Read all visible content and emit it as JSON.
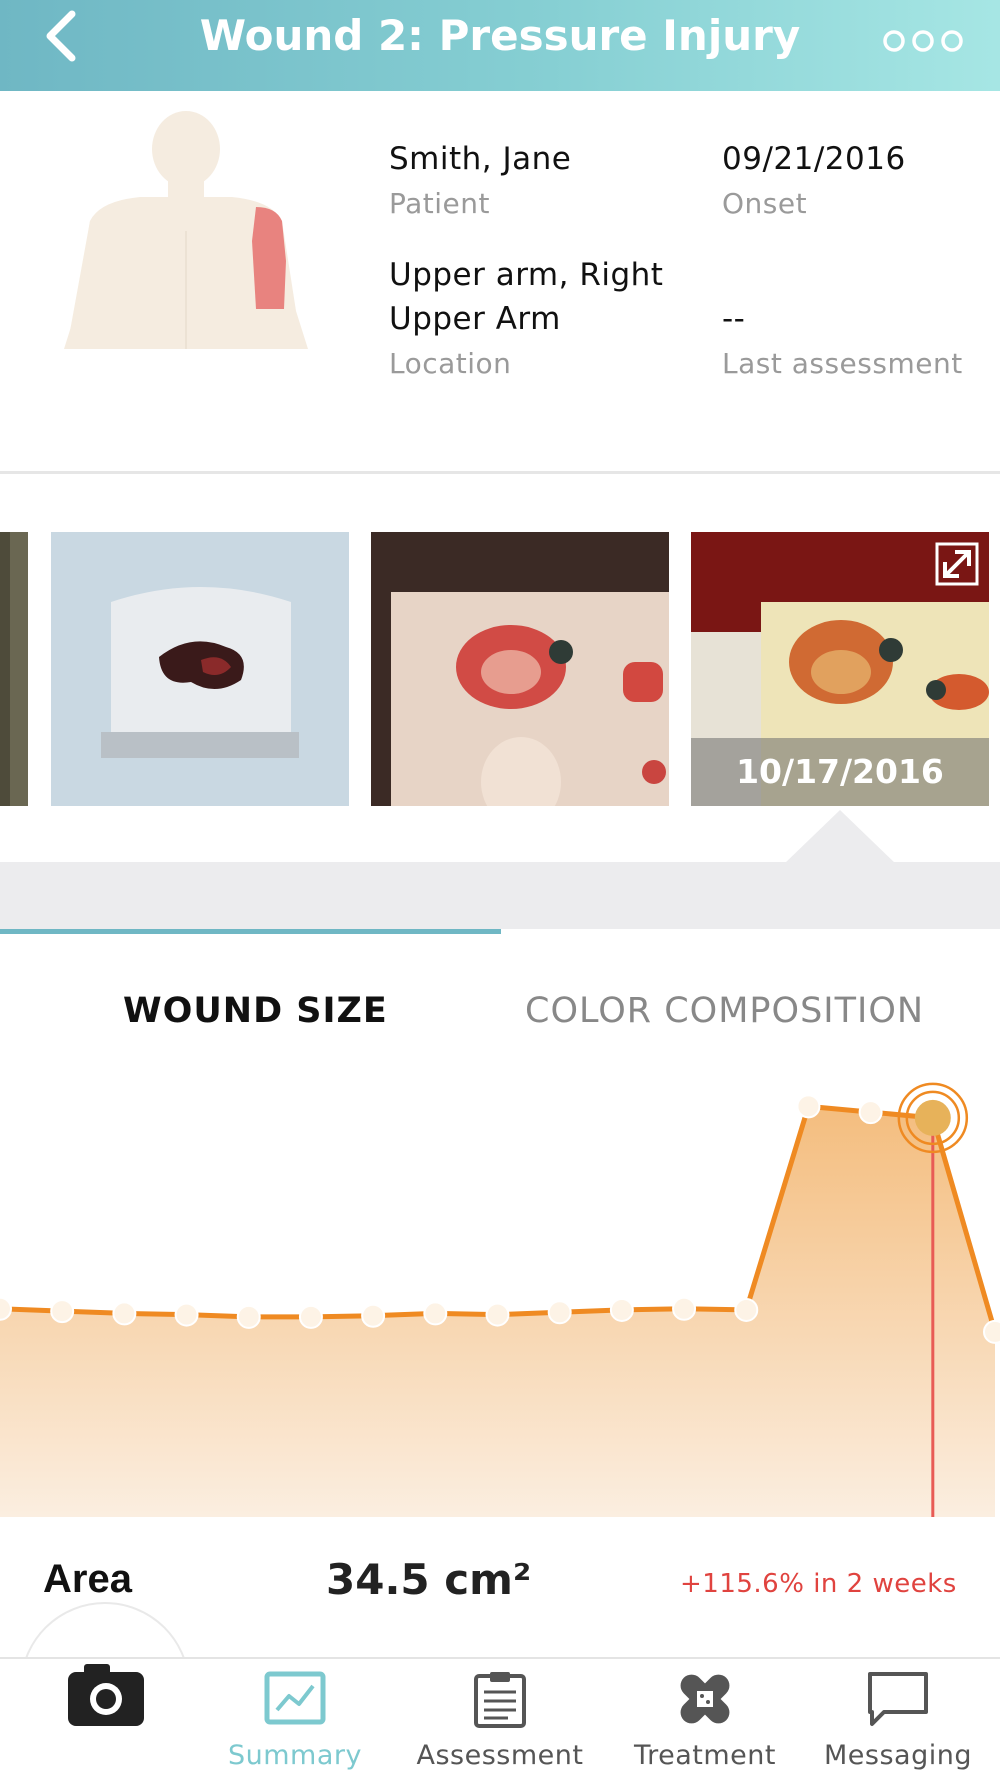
{
  "header": {
    "title": "Wound 2: Pressure Injury",
    "back_icon": "chevron-left-icon",
    "more_icon": "more-dots-icon",
    "colors": {
      "gradient_start": "#6fb7c4",
      "gradient_end": "#a6e6e4"
    }
  },
  "patient": {
    "name": "Smith, Jane",
    "name_label": "Patient",
    "onset": "09/21/2016",
    "onset_label": "Onset",
    "location_line1": "Upper arm, Right",
    "location_line2": "Upper Arm",
    "location_label": "Location",
    "last_assessment": "--",
    "last_assessment_label": "Last assessment",
    "body_map": {
      "highlighted_region": "right upper arm",
      "highlight_color": "#e8837f",
      "skin_color": "#f5ece0"
    }
  },
  "gallery": {
    "selected_date": "10/17/2016",
    "expand_icon": "expand-icon"
  },
  "tabs": {
    "items": [
      {
        "label": "WOUND SIZE",
        "active": true
      },
      {
        "label": "COLOR COMPOSITION",
        "active": false
      }
    ],
    "indicator_color": "#6fb7c4"
  },
  "chart_data": {
    "type": "area",
    "series": [
      {
        "values": [
          18.0,
          17.8,
          17.6,
          17.5,
          17.3,
          17.3,
          17.4,
          17.6,
          17.5,
          17.7,
          17.9,
          18.0,
          17.9,
          35.5,
          35.0,
          34.5,
          16.0
        ]
      }
    ],
    "selected_index": 15,
    "colors": {
      "line": "#ef8a22",
      "fill_top": "#f4bd7e",
      "fill_bottom": "#fbeee0",
      "marker": "#e7b25a",
      "cursor": "#e85b55"
    }
  },
  "metric": {
    "label": "Area",
    "value": "34.5 cm²",
    "change": "+115.6% in 2 weeks"
  },
  "nav": {
    "camera_icon": "camera-icon",
    "items": [
      {
        "label": "Summary",
        "icon": "summary-chart-icon",
        "active": true
      },
      {
        "label": "Assessment",
        "icon": "clipboard-icon",
        "active": false
      },
      {
        "label": "Treatment",
        "icon": "bandage-icon",
        "active": false
      },
      {
        "label": "Messaging",
        "icon": "speech-bubble-icon",
        "active": false
      }
    ],
    "active_color": "#7dc9cf"
  }
}
